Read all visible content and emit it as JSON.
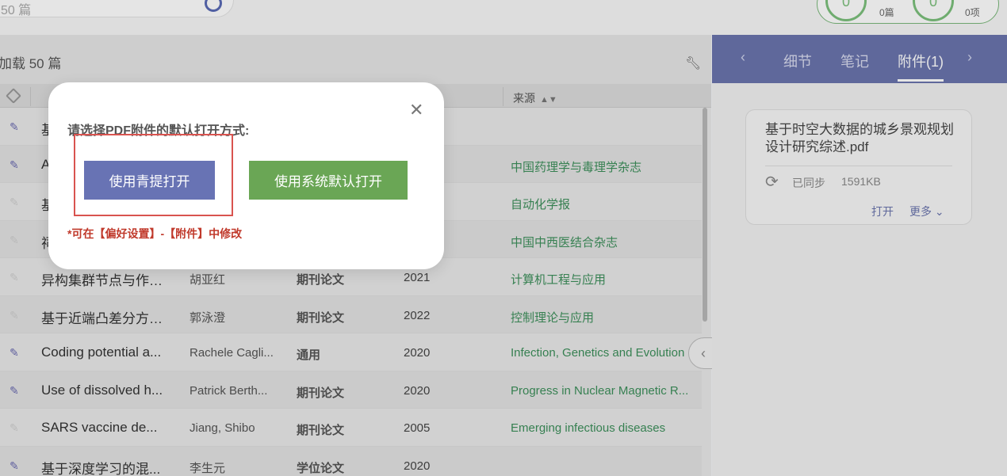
{
  "topbar": {
    "search_placeholder": "50 篇",
    "stat1_value": "0",
    "stat1_label": "0篇",
    "stat2_value": "0",
    "stat2_label": "0项"
  },
  "main": {
    "load_count": "加载 50 篇",
    "col_source": "来源",
    "rows": [
      {
        "title": "基",
        "author": "",
        "type": "",
        "year": "",
        "source": "",
        "pencil": "active"
      },
      {
        "title": "A",
        "author": "",
        "type": "",
        "year": "",
        "source": "中国药理学与毒理学杂志",
        "pencil": "active"
      },
      {
        "title": "基",
        "author": "",
        "type": "",
        "year": "",
        "source": "自动化学报",
        "pencil": "dim"
      },
      {
        "title": "祠",
        "author": "",
        "type": "",
        "year": "",
        "source": "中国中西医结合杂志",
        "pencil": "dim"
      },
      {
        "title": "异构集群节点与作业...",
        "author": "胡亚红",
        "type": "期刊论文",
        "year": "2021",
        "source": "计算机工程与应用",
        "pencil": "dim"
      },
      {
        "title": "基于近端凸差分方法...",
        "author": "郭泳澄",
        "type": "期刊论文",
        "year": "2022",
        "source": "控制理论与应用",
        "pencil": "dim"
      },
      {
        "title": "Coding potential a...",
        "author": "Rachele Cagli...",
        "type": "通用",
        "year": "2020",
        "source": "Infection, Genetics and Evolution",
        "pencil": "active"
      },
      {
        "title": "Use of dissolved h...",
        "author": "Patrick Berth...",
        "type": "期刊论文",
        "year": "2020",
        "source": "Progress in Nuclear Magnetic R...",
        "pencil": "active"
      },
      {
        "title": "SARS vaccine de...",
        "author": "Jiang, Shibo",
        "type": "期刊论文",
        "year": "2005",
        "source": "Emerging infectious diseases",
        "pencil": "dim"
      },
      {
        "title": "基于深度学习的混...",
        "author": "李生元",
        "type": "学位论文",
        "year": "2020",
        "source": "",
        "pencil": "active"
      }
    ]
  },
  "right_panel": {
    "tab_detail": "细节",
    "tab_notes": "笔记",
    "tab_attachments": "附件(1)",
    "attachment": {
      "filename": "基于时空大数据的城乡景观规划设计研究综述.pdf",
      "sync_status": "已同步",
      "size": "1591KB",
      "open_label": "打开",
      "more_label": "更多"
    }
  },
  "modal": {
    "prompt": "请选择PDF附件的默认打开方式:",
    "btn_qingti": "使用青提打开",
    "btn_system": "使用系统默认打开",
    "note": "*可在【偏好设置】-【附件】中修改"
  },
  "icons": {
    "pencil": "pencil-icon",
    "close": "close-icon",
    "search": "search-icon",
    "sync": "sync-icon",
    "wrench": "wrench-icon"
  },
  "colors": {
    "accent": "#6873b4",
    "green_button": "#6aa655",
    "note_red": "#c0392b",
    "source_green": "#3d8f5b"
  }
}
